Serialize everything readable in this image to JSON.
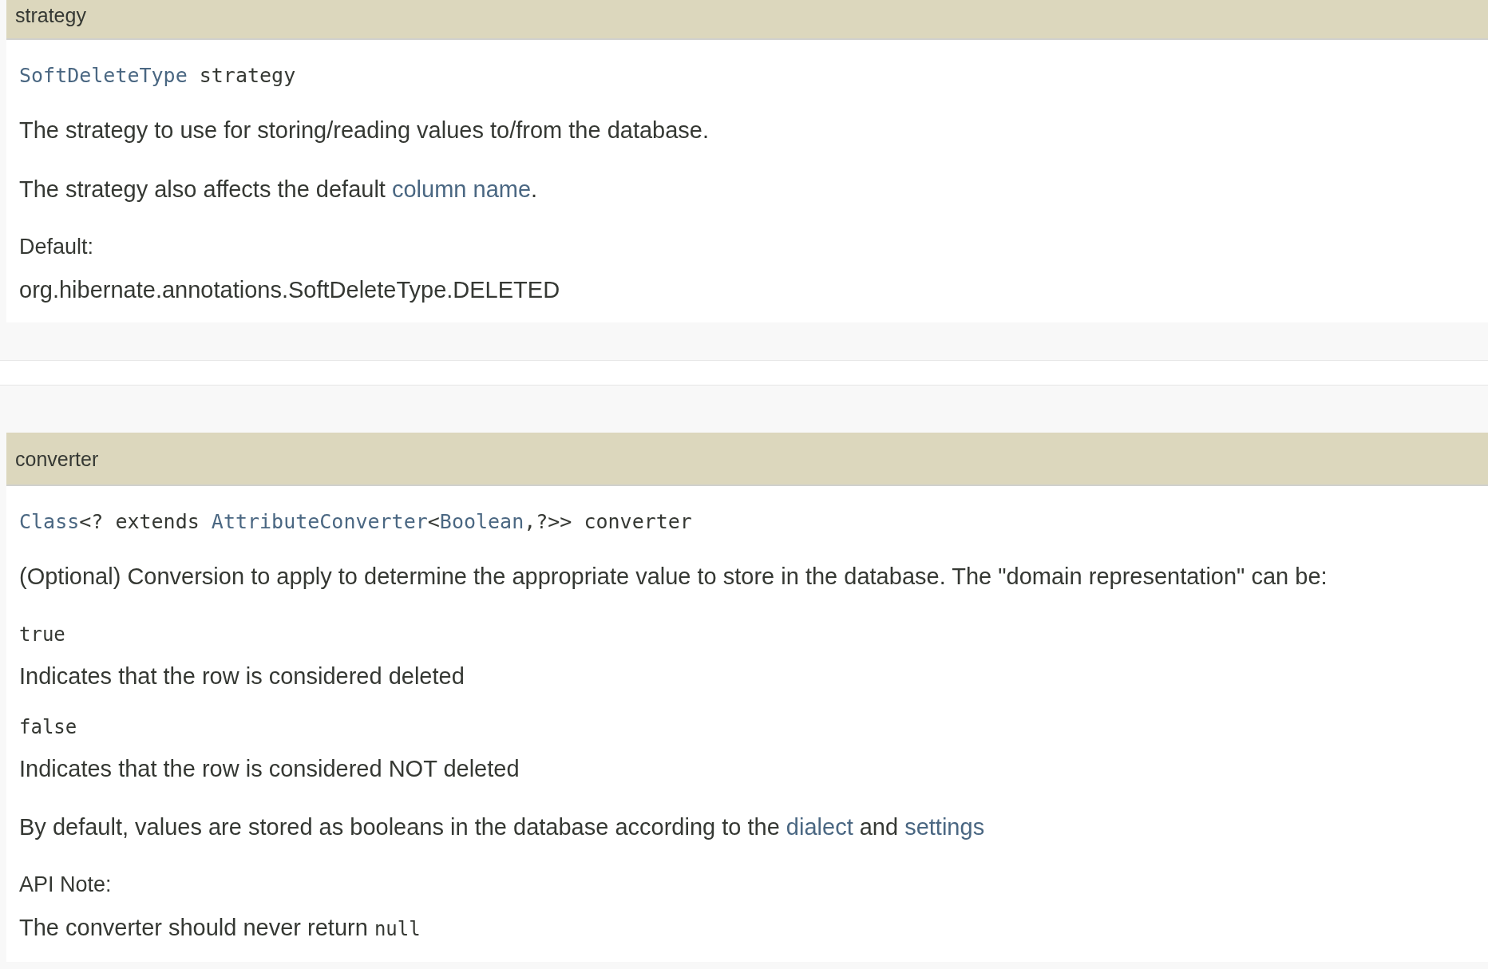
{
  "sections": [
    {
      "name": "strategy",
      "signature": [
        {
          "text": "SoftDeleteType",
          "kind": "link"
        },
        {
          "text": " strategy",
          "kind": "text"
        }
      ],
      "blocks": [
        {
          "kind": "para",
          "segments": [
            {
              "text": "The strategy to use for storing/reading values to/from the database.",
              "kind": "text"
            }
          ]
        },
        {
          "kind": "para",
          "segments": [
            {
              "text": "The strategy also affects the default ",
              "kind": "text"
            },
            {
              "text": "column name",
              "kind": "link"
            },
            {
              "text": ".",
              "kind": "text"
            }
          ]
        },
        {
          "kind": "note",
          "label": "Default:",
          "segments": [
            {
              "text": "org.hibernate.annotations.SoftDeleteType.DELETED",
              "kind": "text"
            }
          ]
        }
      ]
    },
    {
      "name": "converter",
      "signature": [
        {
          "text": "Class",
          "kind": "link"
        },
        {
          "text": "<? extends ",
          "kind": "text"
        },
        {
          "text": "AttributeConverter",
          "kind": "link"
        },
        {
          "text": "<",
          "kind": "text"
        },
        {
          "text": "Boolean",
          "kind": "link"
        },
        {
          "text": ",?>> converter",
          "kind": "text"
        }
      ],
      "blocks": [
        {
          "kind": "para",
          "segments": [
            {
              "text": "(Optional) Conversion to apply to determine the appropriate value to store in the database. The \"domain representation\" can be:",
              "kind": "text"
            }
          ]
        },
        {
          "kind": "deflist",
          "items": [
            {
              "term": "true",
              "desc": "Indicates that the row is considered deleted"
            },
            {
              "term": "false",
              "desc": "Indicates that the row is considered NOT deleted"
            }
          ]
        },
        {
          "kind": "para",
          "segments": [
            {
              "text": "By default, values are stored as booleans in the database according to the ",
              "kind": "text"
            },
            {
              "text": "dialect",
              "kind": "link"
            },
            {
              "text": " and ",
              "kind": "text"
            },
            {
              "text": "settings",
              "kind": "link"
            }
          ]
        },
        {
          "kind": "note",
          "label": "API Note:",
          "segments": [
            {
              "text": "The converter should never return ",
              "kind": "text"
            },
            {
              "text": "null",
              "kind": "code"
            }
          ]
        }
      ]
    }
  ]
}
